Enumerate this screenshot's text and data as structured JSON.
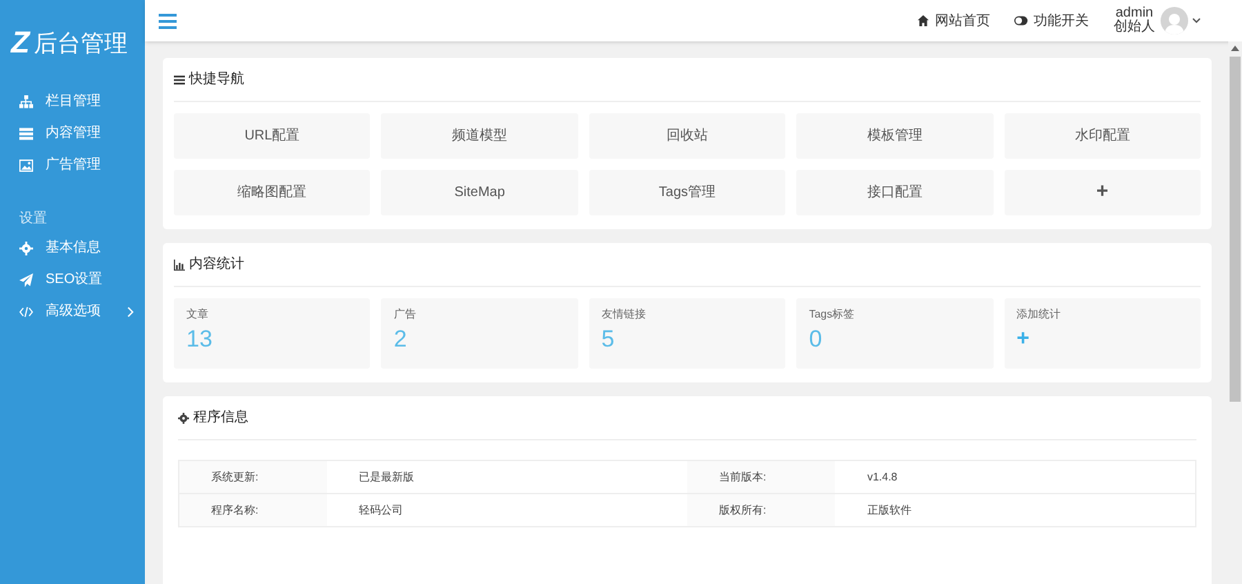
{
  "sidebar": {
    "logo": {
      "mark": "Z",
      "text": "后台管理"
    },
    "groups": [
      {
        "items": [
          {
            "label": "栏目管理",
            "submenu": false
          },
          {
            "label": "内容管理",
            "submenu": false
          },
          {
            "label": "广告管理",
            "submenu": false
          }
        ]
      },
      {
        "title": "设置",
        "items": [
          {
            "label": "基本信息",
            "submenu": false
          },
          {
            "label": "SEO设置",
            "submenu": false
          },
          {
            "label": "高级选项",
            "submenu": true
          }
        ]
      }
    ]
  },
  "header": {
    "links": [
      {
        "label": "网站首页"
      },
      {
        "label": "功能开关"
      }
    ],
    "user": {
      "name": "admin",
      "role": "创始人"
    }
  },
  "quick_nav": {
    "title": "快捷导航",
    "items": [
      {
        "kind": "text",
        "label": "URL配置"
      },
      {
        "kind": "text",
        "label": "频道模型"
      },
      {
        "kind": "text",
        "label": "回收站"
      },
      {
        "kind": "text",
        "label": "模板管理"
      },
      {
        "kind": "text",
        "label": "水印配置"
      },
      {
        "kind": "text",
        "label": "缩略图配置"
      },
      {
        "kind": "text",
        "label": "SiteMap"
      },
      {
        "kind": "text",
        "label": "Tags管理"
      },
      {
        "kind": "text",
        "label": "接口配置"
      },
      {
        "kind": "add",
        "label": "+"
      }
    ]
  },
  "stats": {
    "title": "内容统计",
    "items": [
      {
        "kind": "count",
        "label": "文章",
        "value": "13"
      },
      {
        "kind": "count",
        "label": "广告",
        "value": "2"
      },
      {
        "kind": "count",
        "label": "友情链接",
        "value": "5"
      },
      {
        "kind": "count",
        "label": "Tags标签",
        "value": "0"
      },
      {
        "kind": "add",
        "label": "添加统计",
        "value": "+"
      }
    ]
  },
  "program_info": {
    "title": "程序信息",
    "rows": [
      [
        "系统更新:",
        "已是最新版",
        "当前版本:",
        "v1.4.8"
      ],
      [
        "程序名称:",
        "轻码公司",
        "版权所有:",
        "正版软件"
      ]
    ]
  }
}
